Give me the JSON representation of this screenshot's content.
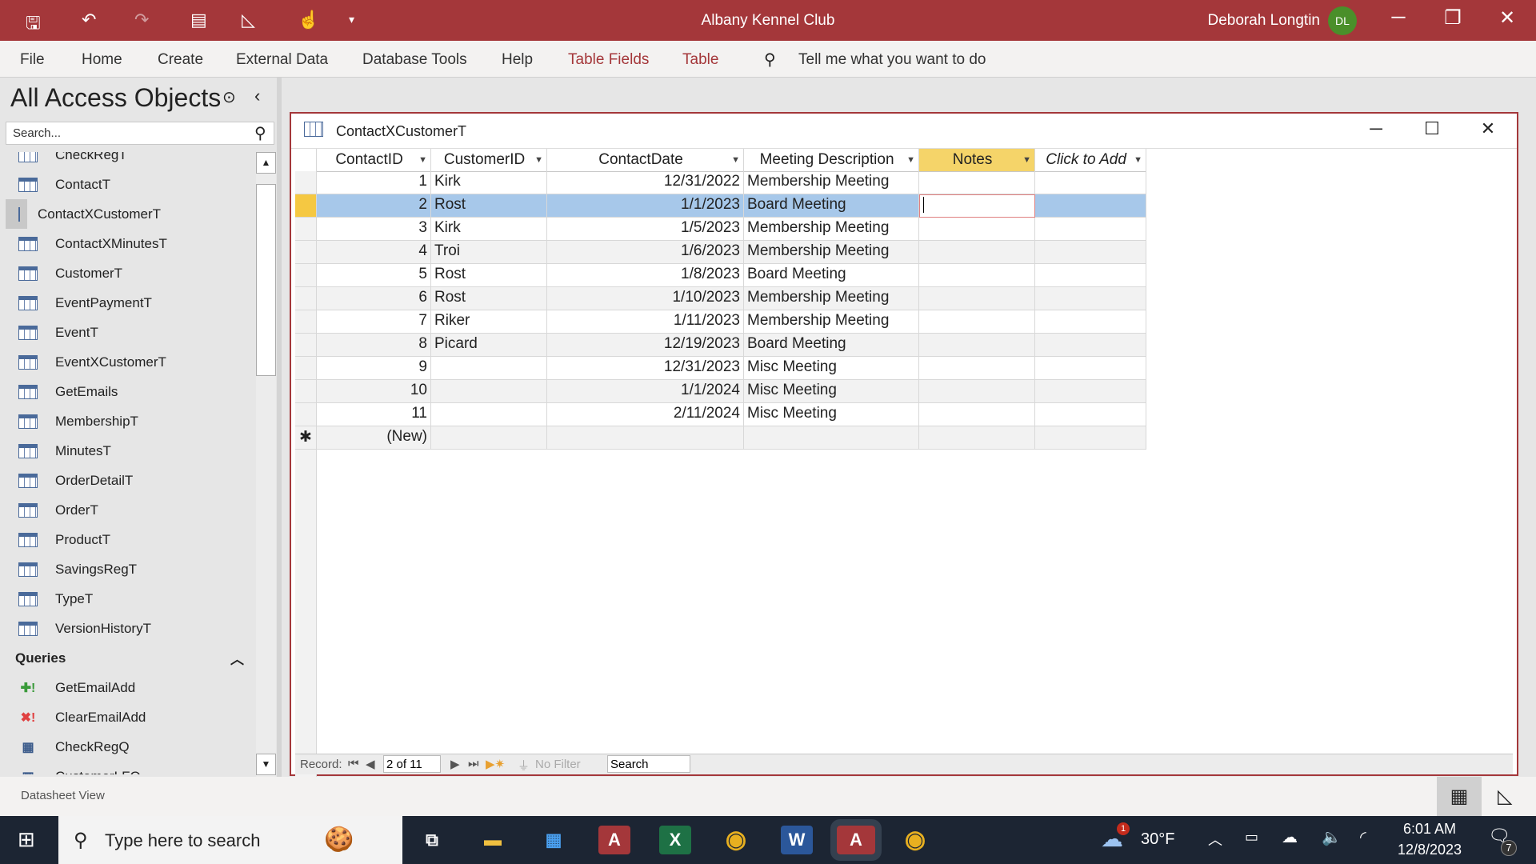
{
  "app": {
    "title": "Albany Kennel Club",
    "user": "Deborah Longtin",
    "initials": "DL"
  },
  "ribbon": {
    "tabs": [
      "File",
      "Home",
      "Create",
      "External Data",
      "Database Tools",
      "Help",
      "Table Fields",
      "Table"
    ],
    "tell_me": "Tell me what you want to do"
  },
  "nav": {
    "title": "All Access Objects",
    "search_placeholder": "Search...",
    "tables": [
      "CheckRegT",
      "ContactT",
      "ContactXCustomerT",
      "ContactXMinutesT",
      "CustomerT",
      "EventPaymentT",
      "EventT",
      "EventXCustomerT",
      "GetEmails",
      "MembershipT",
      "MinutesT",
      "OrderDetailT",
      "OrderT",
      "ProductT",
      "SavingsRegT",
      "TypeT",
      "VersionHistoryT"
    ],
    "selected": "ContactXCustomerT",
    "queries_header": "Queries",
    "queries": [
      "GetEmailAdd",
      "ClearEmailAdd",
      "CheckRegQ",
      "CustomerLFQ"
    ]
  },
  "doc": {
    "title": "ContactXCustomerT",
    "columns": [
      "ContactID",
      "CustomerID",
      "ContactDate",
      "Meeting Description",
      "Notes",
      "Click to Add"
    ],
    "rows": [
      [
        "1",
        "Kirk",
        "12/31/2022",
        "Membership Meeting"
      ],
      [
        "2",
        "Rost",
        "1/1/2023",
        "Board Meeting"
      ],
      [
        "3",
        "Kirk",
        "1/5/2023",
        "Membership Meeting"
      ],
      [
        "4",
        "Troi",
        "1/6/2023",
        "Membership Meeting"
      ],
      [
        "5",
        "Rost",
        "1/8/2023",
        "Board Meeting"
      ],
      [
        "6",
        "Rost",
        "1/10/2023",
        "Membership Meeting"
      ],
      [
        "7",
        "Riker",
        "1/11/2023",
        "Membership Meeting"
      ],
      [
        "8",
        "Picard",
        "12/19/2023",
        "Board Meeting"
      ],
      [
        "9",
        "",
        "12/31/2023",
        "Misc Meeting"
      ],
      [
        "10",
        "",
        "1/1/2024",
        "Misc Meeting"
      ],
      [
        "11",
        "",
        "2/11/2024",
        "Misc Meeting"
      ]
    ],
    "new_row": "(New)",
    "current_row": 1,
    "record_label": "Record:",
    "record_pos": "2 of 11",
    "filter": "No Filter",
    "search": "Search"
  },
  "status": {
    "view": "Datasheet View"
  },
  "taskbar": {
    "search": "Type here to search",
    "weather": "30°F",
    "weather_badge": "1",
    "time": "6:01 AM",
    "date": "12/8/2023",
    "notif": "7"
  }
}
